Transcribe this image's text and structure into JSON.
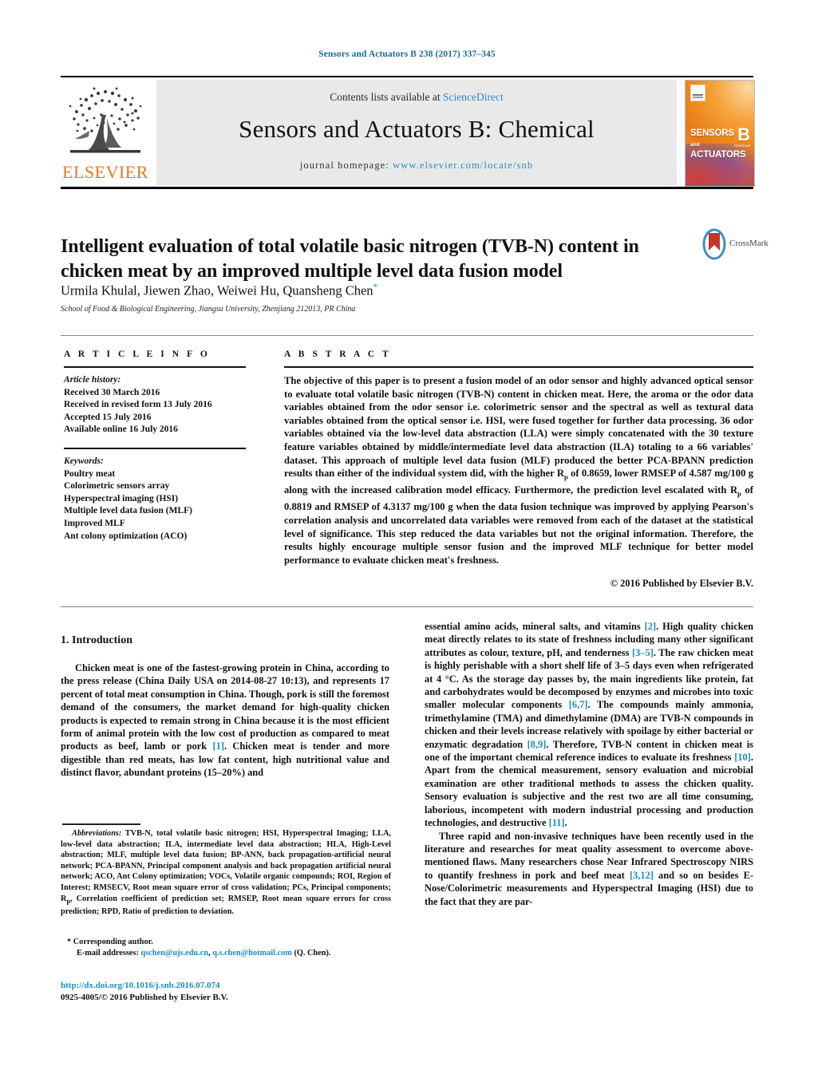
{
  "running_head": "Sensors and Actuators B 238 (2017) 337–345",
  "masthead": {
    "contents_prefix": "Contents lists available at ",
    "contents_link": "ScienceDirect",
    "journal_name": "Sensors and Actuators B: Chemical",
    "homepage_prefix": "journal homepage: ",
    "homepage_url": "www.elsevier.com/locate/snb",
    "publisher": "ELSEVIER",
    "cover": {
      "line1": "SENSORS",
      "line1_small": "and",
      "line2": "ACTUATORS",
      "volume_letter": "B",
      "volume_sub": "Chemical"
    },
    "accent_blue": "#2b8cbe",
    "elsevier_orange": "#E87722",
    "panel_gray": "#e9e9e9"
  },
  "article": {
    "title": "Intelligent evaluation of total volatile basic nitrogen (TVB-N) content in chicken meat by an improved multiple level data fusion model",
    "authors": "Urmila Khulal, Jiewen Zhao, Weiwei Hu, Quansheng Chen",
    "corresponding_marker": "*",
    "affiliation": "School of Food & Biological Engineering, Jiangsu University, Zhenjiang 212013, PR China",
    "crossmark_label": "CrossMark"
  },
  "article_info": {
    "heading": "A R T I C L E   I N F O",
    "history_label": "Article history:",
    "history": [
      "Received 30 March 2016",
      "Received in revised form 13 July 2016",
      "Accepted 15 July 2016",
      "Available online 16 July 2016"
    ],
    "keywords_label": "Keywords:",
    "keywords": [
      "Poultry meat",
      "Colorimetric sensors array",
      "Hyperspectral imaging (HSI)",
      "Multiple level data fusion (MLF)",
      "Improved MLF",
      "Ant colony optimization (ACO)"
    ]
  },
  "abstract": {
    "heading": "A B S T R A C T",
    "text_part1": "The objective of this paper is to present a fusion model of an odor sensor and highly advanced optical sensor to evaluate total volatile basic nitrogen (TVB-N) content in chicken meat. Here, the aroma or the odor data variables obtained from the odor sensor i.e. colorimetric sensor and the spectral as well as textural data variables obtained from the optical sensor i.e. HSI, were fused together for further data processing. 36 odor variables obtained via the low-level data abstraction (LLA) were simply concatenated with the 30 texture feature variables obtained by middle/intermediate level data abstraction (ILA) totaling to a 66 variables' dataset. This approach of multiple level data fusion (MLF) produced the better PCA-BPANN prediction results than either of the individual system did, with the higher R",
    "sub1": "p",
    "text_part2": " of 0.8659, lower RMSEP of 4.587 mg/100 g along with the increased calibration model efficacy. Furthermore, the prediction level escalated with R",
    "sub2": "p",
    "text_part3": " of 0.8819 and RMSEP of 4.3137 mg/100 g when the data fusion technique was improved by applying Pearson's correlation analysis and uncorrelated data variables were removed from each of the dataset at the statistical level of significance. This step reduced the data variables but not the original information. Therefore, the results highly encourage multiple sensor fusion and the improved MLF technique for better model performance to evaluate chicken meat's freshness.",
    "copyright": "© 2016 Published by Elsevier B.V."
  },
  "body": {
    "section_heading": "1.  Introduction",
    "left_paragraph_1a": "Chicken meat is one of the fastest-growing protein in China, according to the press release (China Daily USA on 2014-08-27 10:13), and represents 17 percent of total meat consumption in China. Though, pork is still the foremost demand of the consumers, the market demand for high-quality chicken products is expected to remain strong in China because it is the most efficient form of animal protein with the low cost of production as compared to meat products as beef, lamb or pork ",
    "left_ref_1": "[1]",
    "left_paragraph_1b": ". Chicken meat is tender and more digestible than red meats, has low fat content, high nutritional value and distinct flavor, abundant proteins (15–20%) and",
    "right_p1_a": "essential amino acids, mineral salts, and vitamins ",
    "right_ref_2": "[2]",
    "right_p1_b": ". High quality chicken meat directly relates to its state of freshness including many other significant attributes as colour, texture, pH, and tenderness ",
    "right_ref_3": "[3–5]",
    "right_p1_c": ". The raw chicken meat is highly perishable with a short shelf life of 3–5 days even when refrigerated at 4 °C. As the storage day passes by, the main ingredients like protein, fat and carbohydrates would be decomposed by enzymes and microbes into toxic smaller molecular components ",
    "right_ref_4": "[6,7]",
    "right_p1_d": ". The compounds mainly ammonia, trimethylamine (TMA) and dimethylamine (DMA) are TVB-N compounds in chicken and their levels increase relatively with spoilage by either bacterial or enzymatic degradation ",
    "right_ref_5": "[8,9]",
    "right_p1_e": ". Therefore, TVB-N content in chicken meat is one of the important chemical reference indices to evaluate its freshness ",
    "right_ref_6": "[10]",
    "right_p1_f": ". Apart from the chemical measurement, sensory evaluation and microbial examination are other traditional methods to assess the chicken quality. Sensory evaluation is subjective and the rest two are all time consuming, laborious, incompetent with modern industrial processing and production technologies, and destructive ",
    "right_ref_7": "[11]",
    "right_p1_g": ".",
    "right_p2_a": "Three rapid and non-invasive techniques have been recently used in the literature and researches for meat quality assessment to overcome above-mentioned flaws. Many researchers chose Near Infrared Spectroscopy NIRS to quantify freshness in pork and beef meat ",
    "right_ref_8": "[3,12]",
    "right_p2_b": " and so on besides E-Nose/Colorimetric measurements and Hyperspectral Imaging (HSI) due to the fact that they are par-"
  },
  "footnotes": {
    "abbrev_label": "Abbreviations:",
    "abbrev_text": "  TVB-N, total volatile basic nitrogen; HSI, Hyperspectral Imaging; LLA, low-level data abstraction; ILA, intermediate level data abstraction; HLA, High-Level abstraction; MLF, multiple level data fusion; BP-ANN, back propagation-artificial neural network; PCA-BPANN, Principal component analysis and back propagation artificial neural network; ACO, Ant Colony optimization; VOCs, Volatile organic compounds; ROI, Region of Interest; RMSECV, Root mean square error of cross validation; PCs, Principal components; R",
    "abbrev_sub": "p",
    "abbrev_text2": ", Correlation coefficient of prediction set; RMSEP, Root mean square errors for cross prediction; RPD, Ratio of prediction to deviation.",
    "corresponding_marker": "*",
    "corresponding_label": "Corresponding author.",
    "email_label": "E-mail addresses:",
    "email_1": "qschen@ujs.edu.cn",
    "email_sep": ", ",
    "email_2": "q.s.chen@hotmail.com",
    "email_suffix": " (Q. Chen).",
    "doi_url": "http://dx.doi.org/10.1016/j.snb.2016.07.074",
    "issn_line": "0925-4005/© 2016 Published by Elsevier B.V."
  }
}
